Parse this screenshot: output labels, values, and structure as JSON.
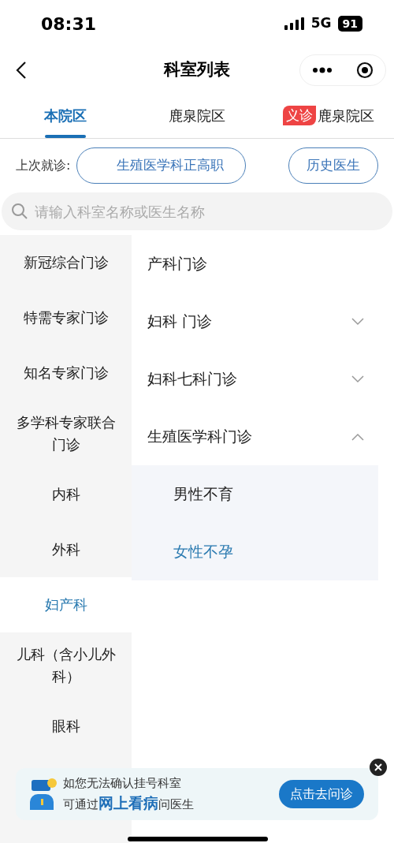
{
  "status_bar": {
    "time": "08:31",
    "network": "5G",
    "battery": "91"
  },
  "nav": {
    "title": "科室列表"
  },
  "tabs": [
    {
      "label": "本院区",
      "selected": true
    },
    {
      "label": "鹿泉院区",
      "selected": false
    },
    {
      "badge": "义诊",
      "label": "鹿泉院区",
      "selected": false
    }
  ],
  "last_visit": {
    "label": "上次就诊:",
    "department": "生殖医学科正高职",
    "history_button": "历史医生"
  },
  "search": {
    "placeholder": "请输入科室名称或医生名称"
  },
  "categories": [
    {
      "label": "新冠综合门诊",
      "selected": false
    },
    {
      "label": "特需专家门诊",
      "selected": false
    },
    {
      "label": "知名专家门诊",
      "selected": false
    },
    {
      "label": "多学科专家联合门诊",
      "selected": false
    },
    {
      "label": "内科",
      "selected": false
    },
    {
      "label": "外科",
      "selected": false
    },
    {
      "label": "妇产科",
      "selected": true
    },
    {
      "label": "儿科（含小儿外科）",
      "selected": false
    },
    {
      "label": "眼科",
      "selected": false
    }
  ],
  "departments": [
    {
      "label": "产科门诊",
      "kind": "leaf"
    },
    {
      "label": "妇科 门诊",
      "kind": "group",
      "expanded": false
    },
    {
      "label": "妇科七科门诊",
      "kind": "group",
      "expanded": false
    },
    {
      "label": "生殖医学科门诊",
      "kind": "group",
      "expanded": true,
      "children": [
        {
          "label": "男性不育",
          "selected": false
        },
        {
          "label": "女性不孕",
          "selected": true
        }
      ]
    }
  ],
  "banner": {
    "line1": "如您无法确认挂号科室",
    "line2": "可通过**网上看病**问医生",
    "button": "点击去问诊"
  }
}
